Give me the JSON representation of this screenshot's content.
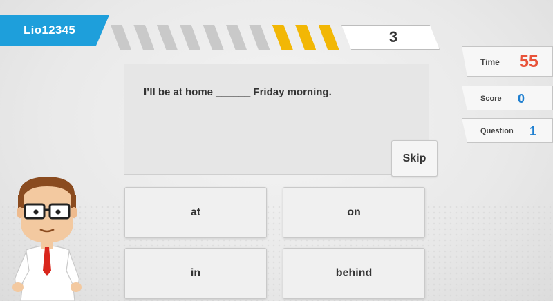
{
  "user": {
    "name": "Lio12345"
  },
  "progress": {
    "total_segments": 10,
    "filled_segments": 3,
    "fill_color": "#f2b705",
    "empty_color": "#c9c9c9",
    "count": "3"
  },
  "question": {
    "text": "I’ll be at home ______ Friday morning."
  },
  "skip_label": "Skip",
  "stats": {
    "time": {
      "label": "Time",
      "value": "55",
      "color": "#e8533a"
    },
    "score": {
      "label": "Score",
      "value": "0",
      "color": "#1e7fd0"
    },
    "question": {
      "label": "Question",
      "value": "1",
      "color": "#1e7fd0"
    }
  },
  "answers": [
    "at",
    "on",
    "in",
    "behind"
  ],
  "accent_color": "#1e9fdb"
}
